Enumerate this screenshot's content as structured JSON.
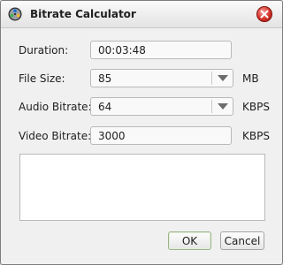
{
  "window": {
    "title": "Bitrate Calculator",
    "icons": {
      "app": "film-reel-icon",
      "close": "close-icon"
    },
    "accent_close": "#d5322a"
  },
  "form": {
    "duration": {
      "label": "Duration:",
      "value": "00:03:48"
    },
    "file_size": {
      "label": "File Size:",
      "value": "85",
      "unit": "MB"
    },
    "audio_bitrate": {
      "label": "Audio Bitrate:",
      "value": "64",
      "unit": "KBPS"
    },
    "video_bitrate": {
      "label": "Video Bitrate:",
      "value": "3000",
      "unit": "KBPS"
    }
  },
  "buttons": {
    "ok": "OK",
    "cancel": "Cancel"
  }
}
